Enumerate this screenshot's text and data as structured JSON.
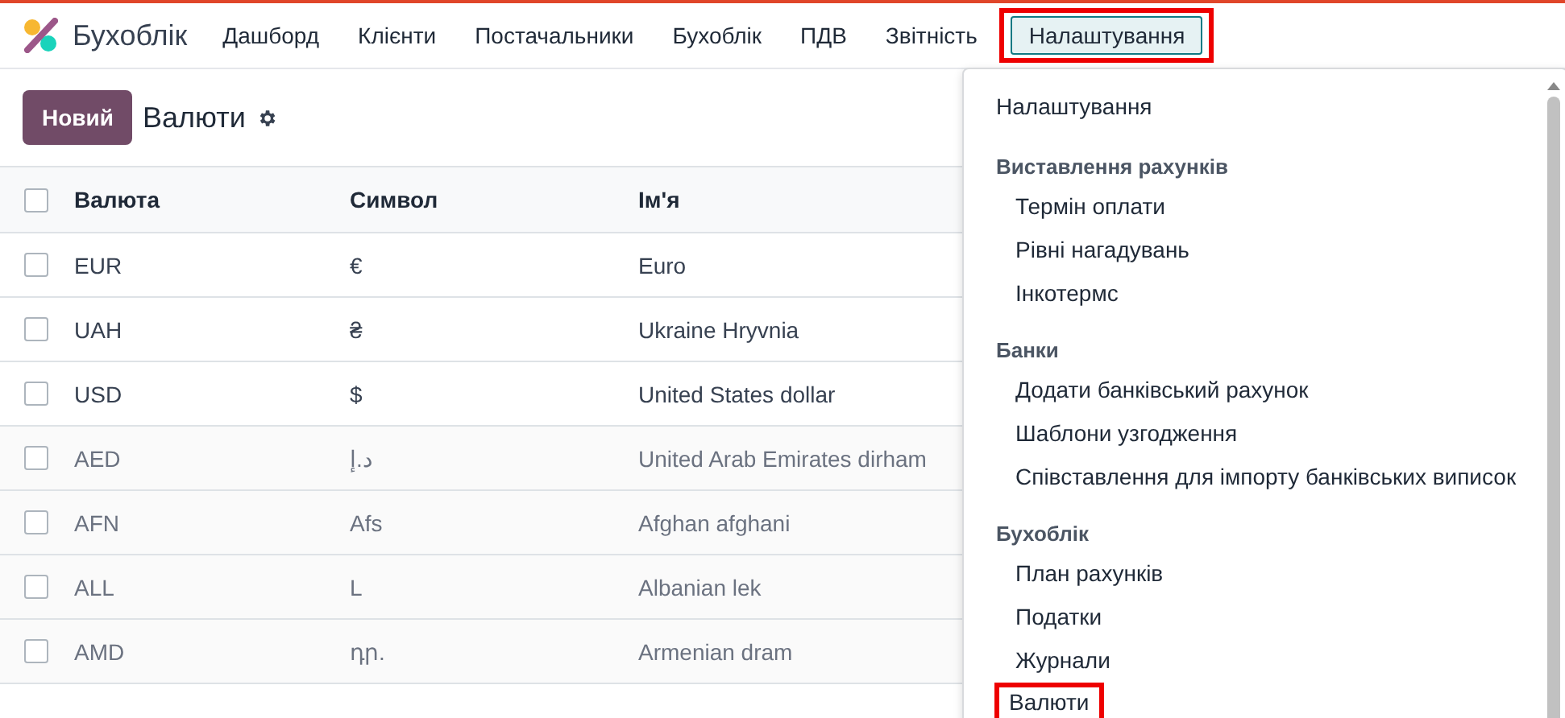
{
  "app": {
    "name": "Бухоблік"
  },
  "nav": [
    {
      "label": "Дашборд",
      "selected": false,
      "highlighted": false
    },
    {
      "label": "Клієнти",
      "selected": false,
      "highlighted": false
    },
    {
      "label": "Постачальники",
      "selected": false,
      "highlighted": false
    },
    {
      "label": "Бухоблік",
      "selected": false,
      "highlighted": false
    },
    {
      "label": "ПДВ",
      "selected": false,
      "highlighted": false
    },
    {
      "label": "Звітність",
      "selected": false,
      "highlighted": false
    },
    {
      "label": "Налаштування",
      "selected": true,
      "highlighted": true
    }
  ],
  "toolbar": {
    "new_button": "Новий",
    "title": "Валюти"
  },
  "table": {
    "all_checked": false,
    "columns": [
      "Валюта",
      "Символ",
      "Ім'я"
    ],
    "rows": [
      {
        "cells": [
          "EUR",
          "€",
          "Euro"
        ],
        "active": true,
        "checked": false
      },
      {
        "cells": [
          "UAH",
          "₴",
          "Ukraine Hryvnia"
        ],
        "active": true,
        "checked": false
      },
      {
        "cells": [
          "USD",
          "$",
          "United States dollar"
        ],
        "active": true,
        "checked": false
      },
      {
        "cells": [
          "AED",
          "د.إ",
          "United Arab Emirates dirham"
        ],
        "active": false,
        "checked": false
      },
      {
        "cells": [
          "AFN",
          "Afs",
          "Afghan afghani"
        ],
        "active": false,
        "checked": false
      },
      {
        "cells": [
          "ALL",
          "L",
          "Albanian lek"
        ],
        "active": false,
        "checked": false
      },
      {
        "cells": [
          "AMD",
          "դր.",
          "Armenian dram"
        ],
        "active": false,
        "checked": false
      }
    ]
  },
  "dropdown": {
    "entries": [
      {
        "kind": "item",
        "label": "Налаштування"
      },
      {
        "kind": "header",
        "label": "Виставлення рахунків"
      },
      {
        "kind": "subitem",
        "label": "Термін оплати"
      },
      {
        "kind": "subitem",
        "label": "Рівні нагадувань"
      },
      {
        "kind": "subitem",
        "label": "Інкотермс"
      },
      {
        "kind": "header",
        "label": "Банки"
      },
      {
        "kind": "subitem",
        "label": "Додати банківський рахунок"
      },
      {
        "kind": "subitem",
        "label": "Шаблони узгодження"
      },
      {
        "kind": "subitem",
        "label": "Співставлення для імпорту банківських виписок"
      },
      {
        "kind": "header",
        "label": "Бухоблік"
      },
      {
        "kind": "subitem",
        "label": "План рахунків"
      },
      {
        "kind": "subitem",
        "label": "Податки"
      },
      {
        "kind": "subitem",
        "label": "Журнали"
      },
      {
        "kind": "subitem",
        "label": "Валюти",
        "highlighted": true
      }
    ]
  }
}
